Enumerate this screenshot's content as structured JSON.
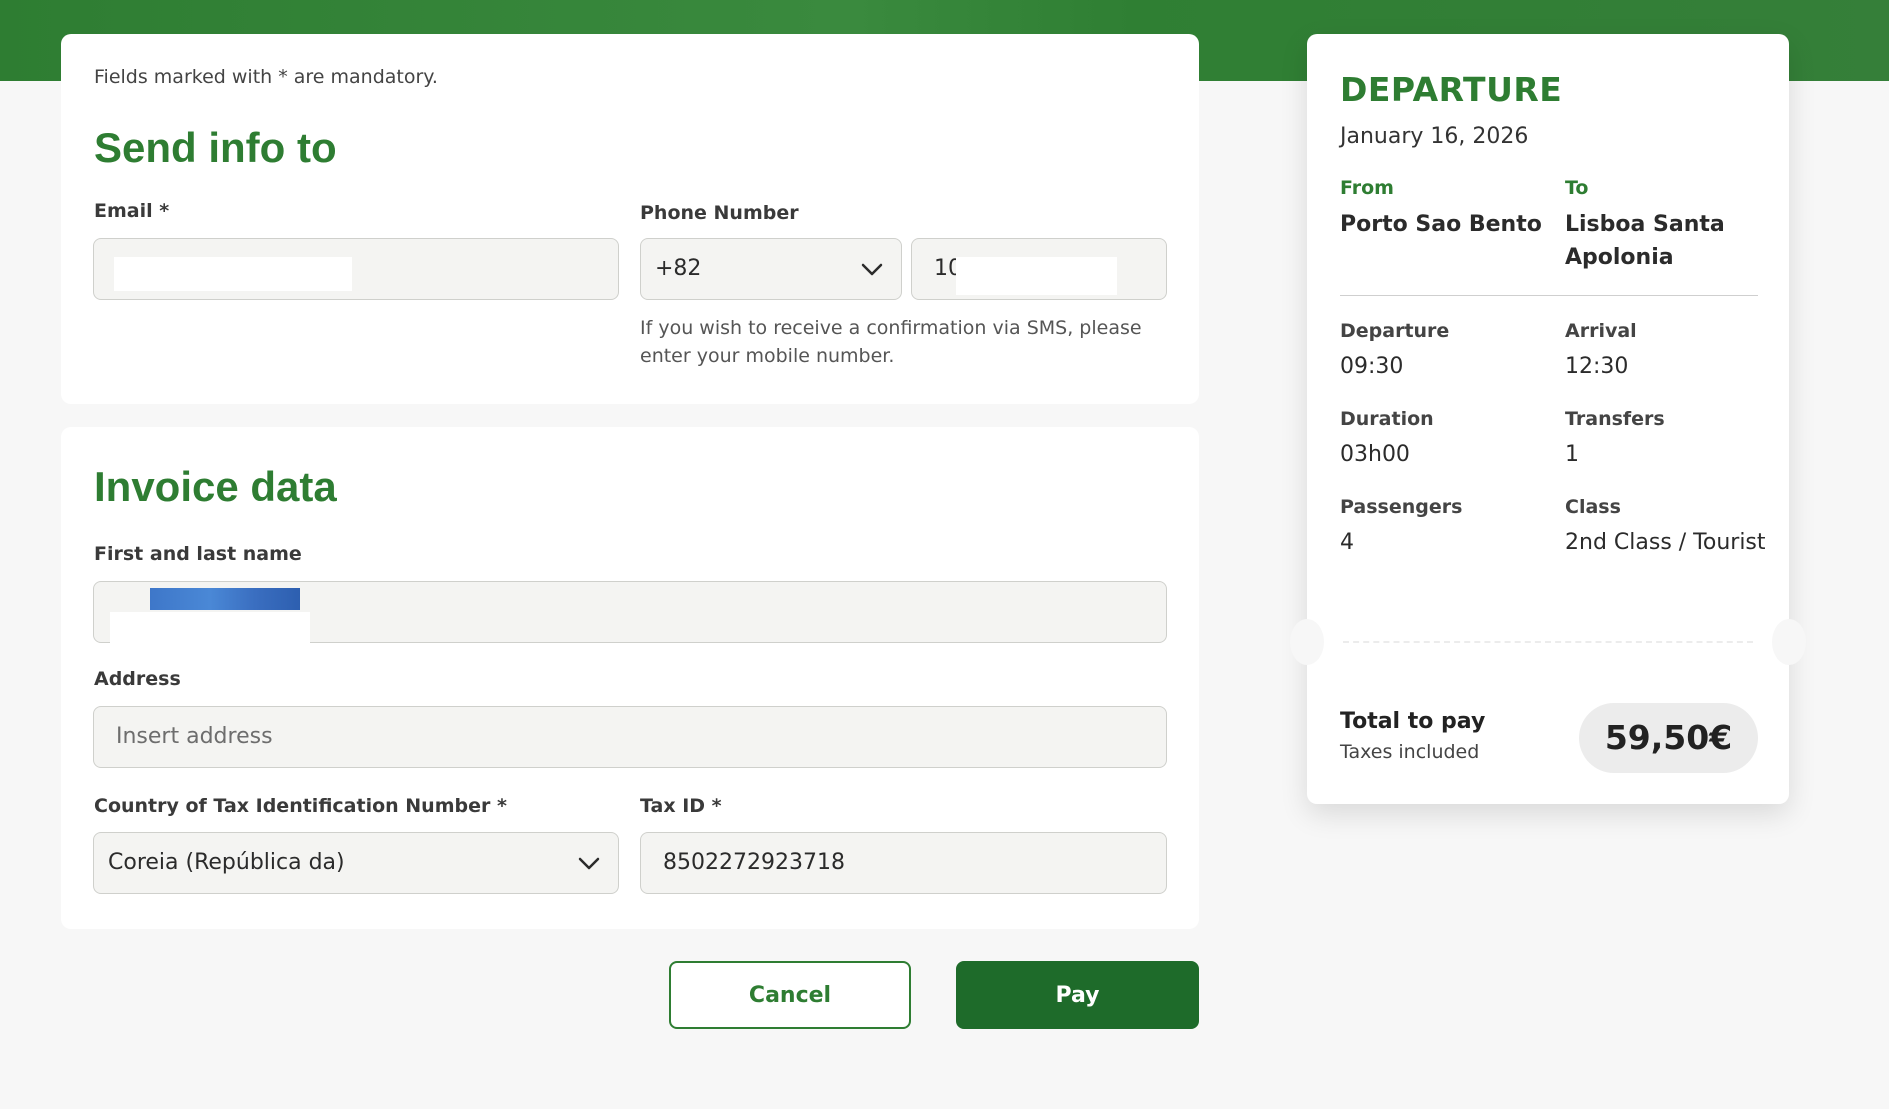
{
  "form": {
    "mandatory_note": "Fields marked with * are mandatory.",
    "send_info": {
      "title": "Send info to",
      "email_label": "Email *",
      "phone_label": "Phone Number",
      "phone_country_code": "+82",
      "phone_number_prefix": "10",
      "phone_helper": "If you wish to receive a confirmation via SMS, please enter your mobile number."
    },
    "invoice": {
      "title": "Invoice data",
      "name_label": "First and last name",
      "address_label": "Address",
      "address_placeholder": "Insert address",
      "tax_country_label": "Country of Tax Identification Number *",
      "tax_country_value": "Coreia (República da)",
      "tax_id_label": "Tax ID *",
      "tax_id_value": "8502272923718"
    },
    "buttons": {
      "cancel": "Cancel",
      "pay": "Pay"
    }
  },
  "summary": {
    "title": "DEPARTURE",
    "date": "January 16, 2026",
    "from_label": "From",
    "from_station": "Porto Sao Bento",
    "to_label": "To",
    "to_station_line1": "Lisboa Santa",
    "to_station_line2": "Apolonia",
    "departure_label": "Departure",
    "departure_time": "09:30",
    "arrival_label": "Arrival",
    "arrival_time": "12:30",
    "duration_label": "Duration",
    "duration_value": "03h00",
    "transfers_label": "Transfers",
    "transfers_value": "1",
    "passengers_label": "Passengers",
    "passengers_value": "4",
    "class_label": "Class",
    "class_value": "2nd Class / Tourist",
    "total_label": "Total to pay",
    "total_sub": "Taxes included",
    "total_amount": "59,50€"
  },
  "colors": {
    "brand_green": "#2e7d32",
    "pay_button": "#1e6b2a",
    "field_background": "#f4f4f2",
    "name_highlight": "#3f7fcf"
  },
  "icons": {
    "dropdown": "chevron-down-icon"
  }
}
